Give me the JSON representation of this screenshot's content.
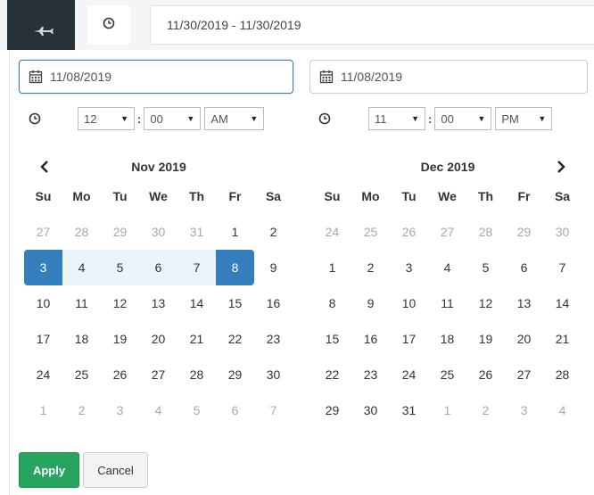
{
  "range_input": {
    "value": "11/30/2019 - 11/30/2019"
  },
  "start": {
    "date": "11/08/2019",
    "hour": "12",
    "minute": "00",
    "ampm": "AM"
  },
  "end": {
    "date": "11/08/2019",
    "hour": "11",
    "minute": "00",
    "ampm": "PM"
  },
  "time_colon": ":",
  "weekdays": [
    "Su",
    "Mo",
    "Tu",
    "We",
    "Th",
    "Fr",
    "Sa"
  ],
  "left_calendar": {
    "title": "Nov 2019",
    "days": [
      [
        "27",
        "28",
        "29",
        "30",
        "31",
        "1",
        "2"
      ],
      [
        "3",
        "4",
        "5",
        "6",
        "7",
        "8",
        "9"
      ],
      [
        "10",
        "11",
        "12",
        "13",
        "14",
        "15",
        "16"
      ],
      [
        "17",
        "18",
        "19",
        "20",
        "21",
        "22",
        "23"
      ],
      [
        "24",
        "25",
        "26",
        "27",
        "28",
        "29",
        "30"
      ],
      [
        "1",
        "2",
        "3",
        "4",
        "5",
        "6",
        "7"
      ]
    ]
  },
  "right_calendar": {
    "title": "Dec 2019",
    "days": [
      [
        "24",
        "25",
        "26",
        "27",
        "28",
        "29",
        "30"
      ],
      [
        "1",
        "2",
        "3",
        "4",
        "5",
        "6",
        "7"
      ],
      [
        "8",
        "9",
        "10",
        "11",
        "12",
        "13",
        "14"
      ],
      [
        "15",
        "16",
        "17",
        "18",
        "19",
        "20",
        "21"
      ],
      [
        "22",
        "23",
        "24",
        "25",
        "26",
        "27",
        "28"
      ],
      [
        "29",
        "30",
        "31",
        "1",
        "2",
        "3",
        "4"
      ]
    ]
  },
  "buttons": {
    "apply": "Apply",
    "cancel": "Cancel"
  },
  "colors": {
    "accent": "#357ebd",
    "range": "#ebf4f8",
    "apply": "#27a55f",
    "nav_dark": "#263238"
  },
  "icons": {
    "prev": "chevron-left-icon",
    "next": "chevron-right-icon",
    "clock": "clock-icon",
    "calendar": "calendar-icon",
    "plane": "plane-icon"
  }
}
